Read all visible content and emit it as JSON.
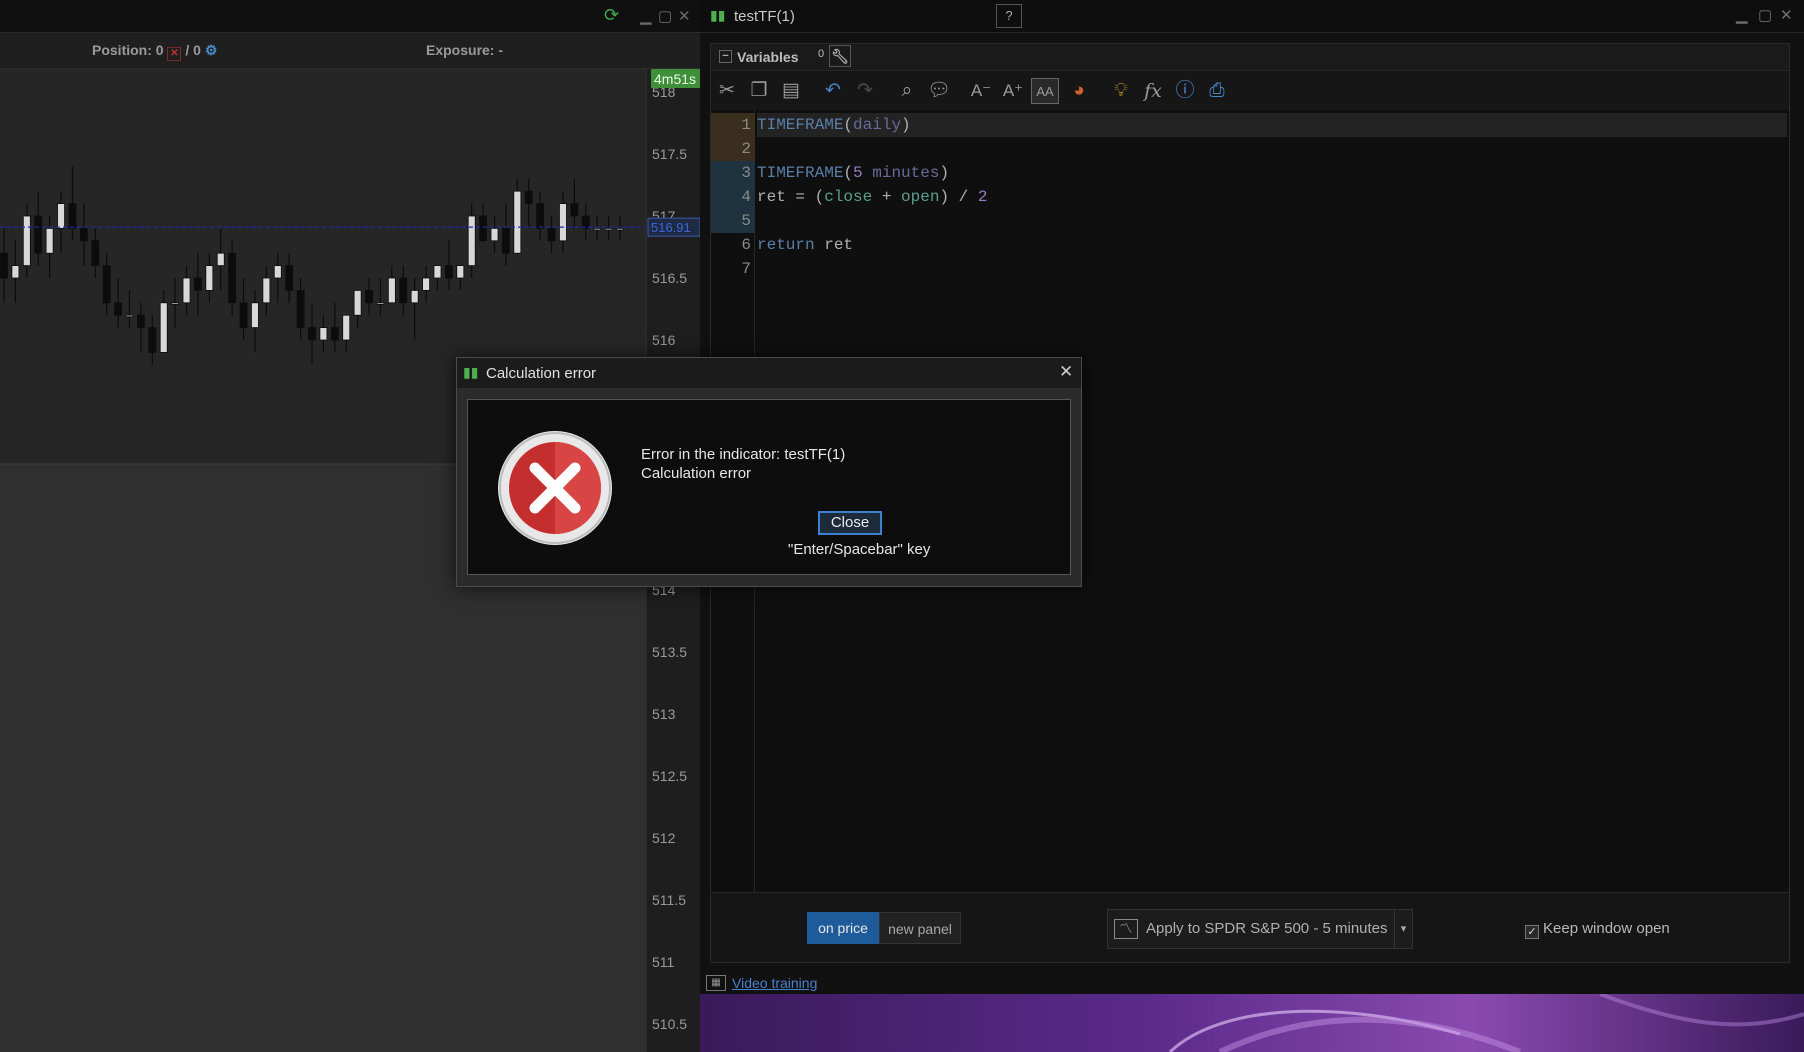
{
  "chart_window": {
    "position_label": "Position: 0",
    "position_suffix": "/ 0",
    "exposure_label": "Exposure: -",
    "timer_badge": "4m51s",
    "last_price": "516.91",
    "price_axis": [
      "518",
      "517.5",
      "517",
      "516.5",
      "516",
      "514",
      "513.5",
      "513",
      "512.5",
      "512",
      "511.5",
      "511",
      "510.5"
    ]
  },
  "editor": {
    "title": "testTF(1)",
    "variables_label": "Variables",
    "variables_count": "0",
    "code_lines": [
      {
        "n": "1",
        "parts": [
          [
            "kw",
            "TIMEFRAME"
          ],
          [
            "plain",
            "("
          ],
          [
            "arg",
            "daily"
          ],
          [
            "plain",
            ")"
          ]
        ]
      },
      {
        "n": "2",
        "parts": []
      },
      {
        "n": "3",
        "parts": [
          [
            "kw",
            "TIMEFRAME"
          ],
          [
            "plain",
            "("
          ],
          [
            "num",
            "5"
          ],
          [
            "plain",
            " "
          ],
          [
            "arg",
            "minutes"
          ],
          [
            "plain",
            ")"
          ]
        ]
      },
      {
        "n": "4",
        "parts": [
          [
            "plain",
            "ret = ("
          ],
          [
            "field",
            "close"
          ],
          [
            "plain",
            " + "
          ],
          [
            "field",
            "open"
          ],
          [
            "plain",
            ") / "
          ],
          [
            "num",
            "2"
          ]
        ]
      },
      {
        "n": "5",
        "parts": []
      },
      {
        "n": "6",
        "parts": [
          [
            "kw",
            "return"
          ],
          [
            "plain",
            " ret"
          ]
        ]
      },
      {
        "n": "7",
        "parts": []
      }
    ],
    "segment_on_price": "on price",
    "segment_new_panel": "new panel",
    "apply_label": "Apply to SPDR S&P 500 - 5 minutes",
    "keep_open_label": "Keep window open",
    "video_training_label": "Video training"
  },
  "dialog": {
    "title": "Calculation error",
    "message_line1": "Error in the indicator: testTF(1)",
    "message_line2": "Calculation error",
    "close_button": "Close",
    "key_hint": "\"Enter/Spacebar\" key"
  },
  "chart_data": {
    "type": "candlestick",
    "last_price": 516.91,
    "y_ticks": [
      518,
      517.5,
      517,
      516.5,
      516,
      514,
      513.5,
      513,
      512.5,
      512,
      511.5,
      511,
      510.5
    ],
    "ohlc": [
      [
        516.7,
        516.9,
        516.3,
        516.5
      ],
      [
        516.5,
        516.8,
        516.3,
        516.6
      ],
      [
        516.6,
        517.1,
        516.5,
        517.0
      ],
      [
        517.0,
        517.2,
        516.6,
        516.7
      ],
      [
        516.7,
        517.0,
        516.5,
        516.9
      ],
      [
        516.9,
        517.2,
        516.7,
        517.1
      ],
      [
        517.1,
        517.4,
        516.8,
        516.9
      ],
      [
        516.9,
        517.1,
        516.6,
        516.8
      ],
      [
        516.8,
        516.9,
        516.5,
        516.6
      ],
      [
        516.6,
        516.7,
        516.2,
        516.3
      ],
      [
        516.3,
        516.5,
        516.1,
        516.2
      ],
      [
        516.2,
        516.4,
        516.1,
        516.2
      ],
      [
        516.2,
        516.3,
        515.9,
        516.1
      ],
      [
        516.1,
        516.2,
        515.8,
        515.9
      ],
      [
        515.9,
        516.4,
        515.9,
        516.3
      ],
      [
        516.3,
        516.5,
        516.1,
        516.3
      ],
      [
        516.3,
        516.6,
        516.2,
        516.5
      ],
      [
        516.5,
        516.7,
        516.2,
        516.4
      ],
      [
        516.4,
        516.7,
        516.3,
        516.6
      ],
      [
        516.6,
        516.9,
        516.4,
        516.7
      ],
      [
        516.7,
        516.8,
        516.2,
        516.3
      ],
      [
        516.3,
        516.5,
        516.0,
        516.1
      ],
      [
        516.1,
        516.4,
        515.9,
        516.3
      ],
      [
        516.3,
        516.6,
        516.2,
        516.5
      ],
      [
        516.5,
        516.7,
        516.3,
        516.6
      ],
      [
        516.6,
        516.7,
        516.3,
        516.4
      ],
      [
        516.4,
        516.5,
        516.0,
        516.1
      ],
      [
        516.1,
        516.3,
        515.8,
        516.0
      ],
      [
        516.0,
        516.2,
        515.9,
        516.1
      ],
      [
        516.1,
        516.3,
        515.9,
        516.0
      ],
      [
        516.0,
        516.2,
        515.9,
        516.2
      ],
      [
        516.2,
        516.4,
        516.1,
        516.4
      ],
      [
        516.4,
        516.5,
        516.2,
        516.3
      ],
      [
        516.3,
        516.5,
        516.2,
        516.3
      ],
      [
        516.3,
        516.6,
        516.3,
        516.5
      ],
      [
        516.5,
        516.6,
        516.2,
        516.3
      ],
      [
        516.3,
        516.5,
        516.0,
        516.4
      ],
      [
        516.4,
        516.6,
        516.3,
        516.5
      ],
      [
        516.5,
        516.6,
        516.4,
        516.6
      ],
      [
        516.6,
        516.8,
        516.4,
        516.5
      ],
      [
        516.5,
        516.6,
        516.4,
        516.6
      ],
      [
        516.6,
        517.1,
        516.5,
        517.0
      ],
      [
        517.0,
        517.1,
        516.8,
        516.8
      ],
      [
        516.8,
        517.0,
        516.7,
        516.9
      ],
      [
        516.9,
        517.1,
        516.6,
        516.7
      ],
      [
        516.7,
        517.3,
        516.7,
        517.2
      ],
      [
        517.2,
        517.3,
        516.9,
        517.1
      ],
      [
        517.1,
        517.2,
        516.8,
        516.9
      ],
      [
        516.9,
        517.0,
        516.7,
        516.8
      ],
      [
        516.8,
        517.2,
        516.7,
        517.1
      ],
      [
        517.1,
        517.3,
        516.9,
        517.0
      ],
      [
        517.0,
        517.1,
        516.8,
        516.9
      ],
      [
        516.9,
        517.0,
        516.8,
        516.9
      ],
      [
        516.9,
        517.0,
        516.8,
        516.9
      ],
      [
        516.9,
        517.0,
        516.8,
        516.9
      ]
    ]
  }
}
